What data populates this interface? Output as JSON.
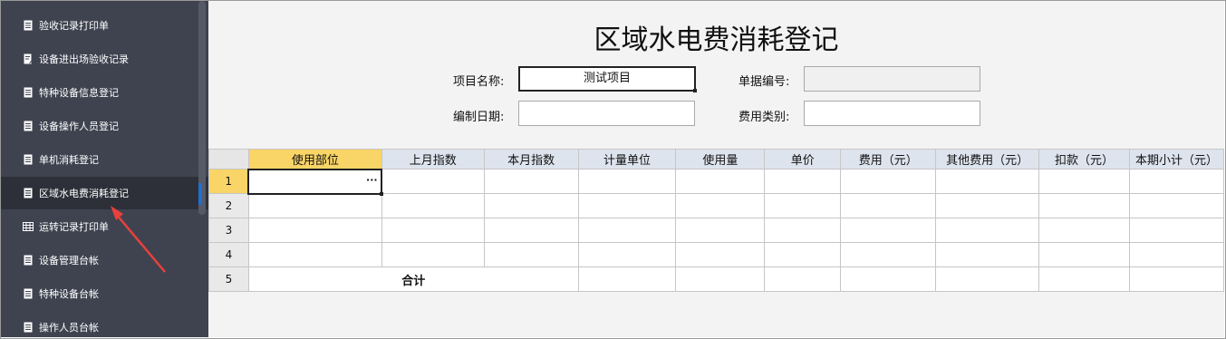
{
  "sidebar": {
    "items": [
      {
        "label": "验收记录打印单",
        "icon": "document-icon"
      },
      {
        "label": "设备进出场验收记录",
        "icon": "edit-document-icon"
      },
      {
        "label": "特种设备信息登记",
        "icon": "document-icon"
      },
      {
        "label": "设备操作人员登记",
        "icon": "document-icon"
      },
      {
        "label": "单机消耗登记",
        "icon": "document-icon"
      },
      {
        "label": "区域水电费消耗登记",
        "icon": "document-icon",
        "active": true
      },
      {
        "label": "运转记录打印单",
        "icon": "table-icon"
      },
      {
        "label": "设备管理台帐",
        "icon": "document-icon"
      },
      {
        "label": "特种设备台帐",
        "icon": "document-icon"
      },
      {
        "label": "操作人员台帐",
        "icon": "document-icon"
      }
    ]
  },
  "form": {
    "title": "区域水电费消耗登记",
    "project_name_label": "项目名称:",
    "project_name_value": "测试项目",
    "doc_no_label": "单据编号:",
    "doc_no_value": "",
    "date_label": "编制日期:",
    "date_value": "",
    "fee_type_label": "费用类别:",
    "fee_type_value": ""
  },
  "grid": {
    "columns": [
      "使用部位",
      "上月指数",
      "本月指数",
      "计量单位",
      "使用量",
      "单价",
      "费用（元）",
      "其他费用（元）",
      "扣款（元）",
      "本期小计（元）"
    ],
    "row_numbers": [
      "1",
      "2",
      "3",
      "4",
      "5"
    ],
    "total_label": "合计",
    "ellipsis": "···"
  },
  "colors": {
    "sidebar_bg": "#3f4350",
    "sidebar_active_bg": "#2d3039",
    "header_bg": "#dde4ee",
    "selected_header_bg": "#f9d466",
    "annotation_arrow": "#e8413c"
  }
}
